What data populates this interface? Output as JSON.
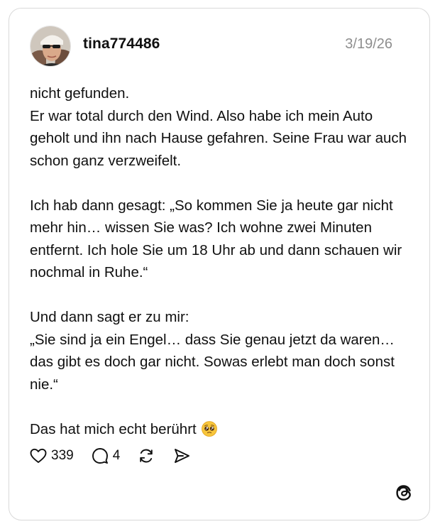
{
  "post": {
    "username": "tina774486",
    "timestamp": "3/19/26",
    "paragraphs": [
      "nicht gefunden.\nEr war total durch den Wind. Also habe ich mein Auto geholt und ihn nach Hause gefahren. Seine Frau war auch schon ganz verzweifelt.",
      "Ich hab dann gesagt: „So kommen Sie ja heute gar nicht mehr hin… wissen Sie was? Ich wohne zwei Minuten entfernt. Ich hole Sie um 18 Uhr ab und dann schauen wir nochmal in Ruhe.“",
      "Und dann sagt er zu mir:\n„Sie sind ja ein Engel… dass Sie genau jetzt da waren… das gibt es doch gar nicht. Sowas erlebt man doch sonst nie.“"
    ],
    "closing_text": "Das hat mich echt berührt",
    "closing_emoji": "pleading-face-emoji"
  },
  "actions": {
    "likes": "339",
    "replies": "4"
  },
  "icons": {
    "like": "heart-icon",
    "reply": "speech-bubble-icon",
    "repost": "repost-icon",
    "share": "send-icon",
    "brand": "threads-logo-icon"
  },
  "colors": {
    "text": "#101010",
    "muted": "#8e8e8e",
    "border": "#d9d9d9"
  }
}
